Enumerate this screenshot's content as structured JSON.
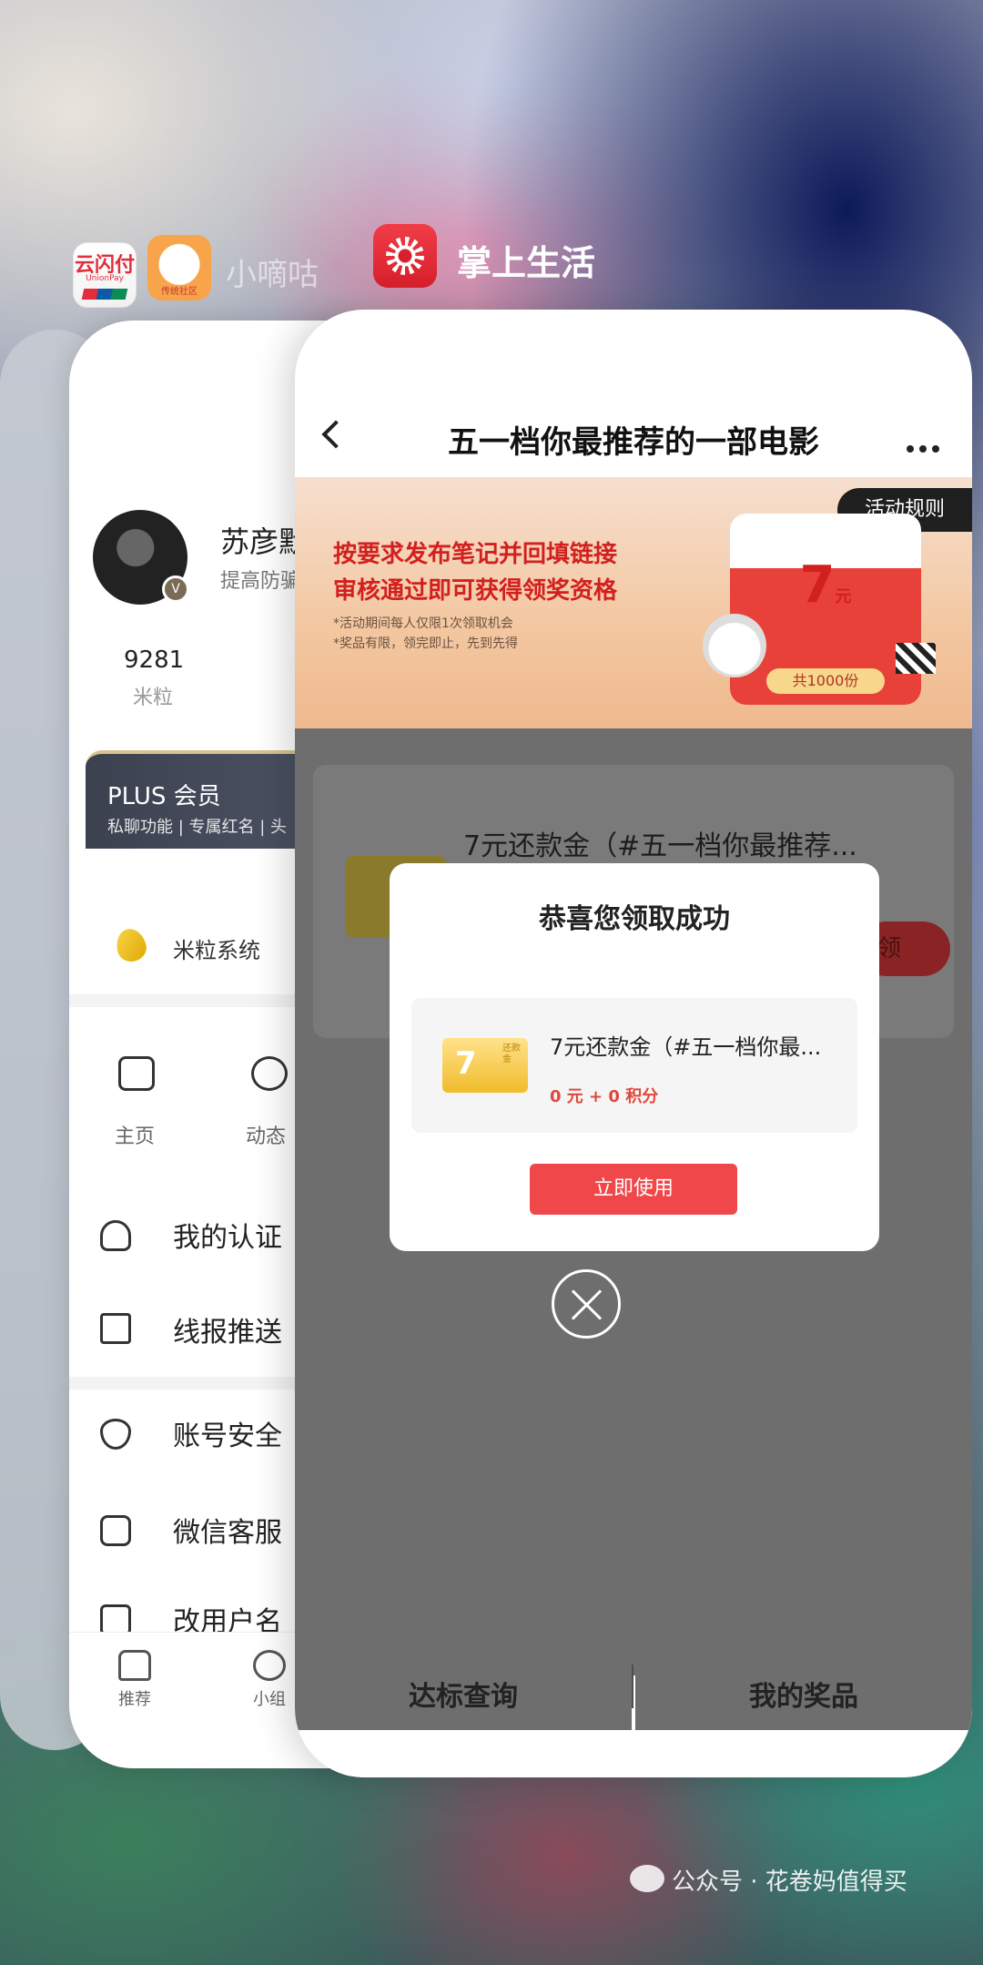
{
  "apps": {
    "left_label": "小嘀咕",
    "front_label": "掌上生活",
    "unionpay_icon_text": "云闪付",
    "unionpay_icon_sub": "UnionPay",
    "xiaodigu_icon_caption": "传统社区"
  },
  "profile_card": {
    "name": "苏彦默",
    "subtitle": "提高防骗",
    "stat_value": "9281",
    "stat_label": "米粒",
    "plus_title": "PLUS 会员",
    "plus_sub": "私聊功能 | 专属红名 | 头",
    "rice_system_label": "米粒系统",
    "quick_items": [
      {
        "label": "主页"
      },
      {
        "label": "动态"
      }
    ],
    "menu_items": [
      {
        "label": "我的认证"
      },
      {
        "label": "线报推送"
      },
      {
        "label": "账号安全"
      },
      {
        "label": "微信客服"
      },
      {
        "label": "改用户名"
      }
    ],
    "tabs": [
      {
        "label": "推荐"
      },
      {
        "label": "小组"
      }
    ]
  },
  "front_card": {
    "nav_title": "五一档你最推荐的一部电影",
    "banner": {
      "rules_label": "活动规则",
      "line1": "按要求发布笔记并回填链接",
      "line2": "审核通过即可获得领奖资格",
      "note1": "*活动期间每人仅限1次领取机会",
      "note2": "*奖品有限，领完即止，先到先得",
      "packet_amount": "7",
      "packet_unit": "元",
      "packet_count": "共1000份"
    },
    "background_item_title": "7元还款金（#五一档你最推荐...",
    "background_claim_label": "领",
    "dialog": {
      "title": "恭喜您领取成功",
      "coupon_number": "7",
      "coupon_tag": "还款金",
      "item_title": "7元还款金（#五一档你最...",
      "item_price": "0 元 + 0 积分",
      "button_label": "立即使用"
    },
    "bottom_tabs": [
      {
        "label": "达标查询"
      },
      {
        "label": "我的奖品"
      }
    ]
  },
  "watermark": "公众号 · 花卷妈值得买",
  "colors": {
    "accent_red": "#f0474a",
    "banner_red": "#d2201f"
  }
}
